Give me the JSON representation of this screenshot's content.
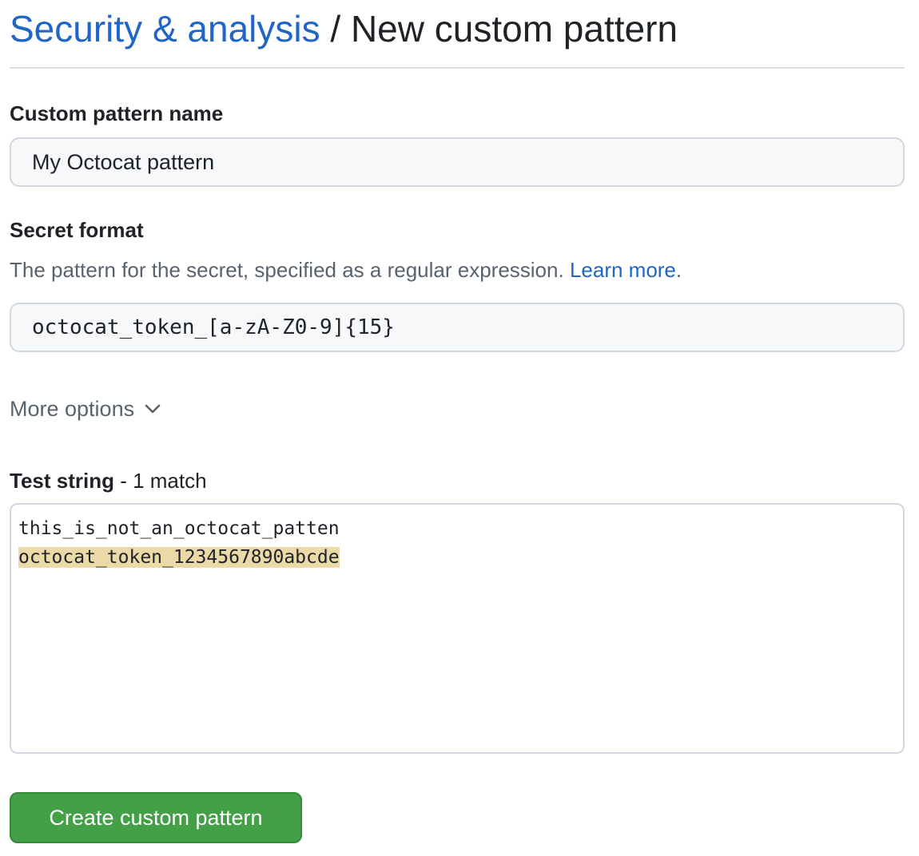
{
  "header": {
    "breadcrumb_link": "Security & analysis",
    "separator": "/",
    "title": "New custom pattern"
  },
  "name_field": {
    "label": "Custom pattern name",
    "value": "My Octocat pattern"
  },
  "secret_format": {
    "label": "Secret format",
    "hint": "The pattern for the secret, specified as a regular expression.",
    "learn_more": "Learn more",
    "hint_end": ".",
    "value": "octocat_token_[a-zA-Z0-9]{15}"
  },
  "more_options": {
    "label": "More options",
    "icon": "chevron-down-icon"
  },
  "test_string": {
    "label": "Test string",
    "match_summary": " - 1 match",
    "lines": [
      "this_is_not_an_octocat_patten",
      "octocat_token_1234567890abcde"
    ],
    "highlight_color": "#ecd9a8"
  },
  "submit": {
    "label": "Create custom pattern",
    "color": "#43a047"
  },
  "colors": {
    "link": "#1f66c7",
    "muted": "#59636e",
    "text": "#1f2328"
  }
}
